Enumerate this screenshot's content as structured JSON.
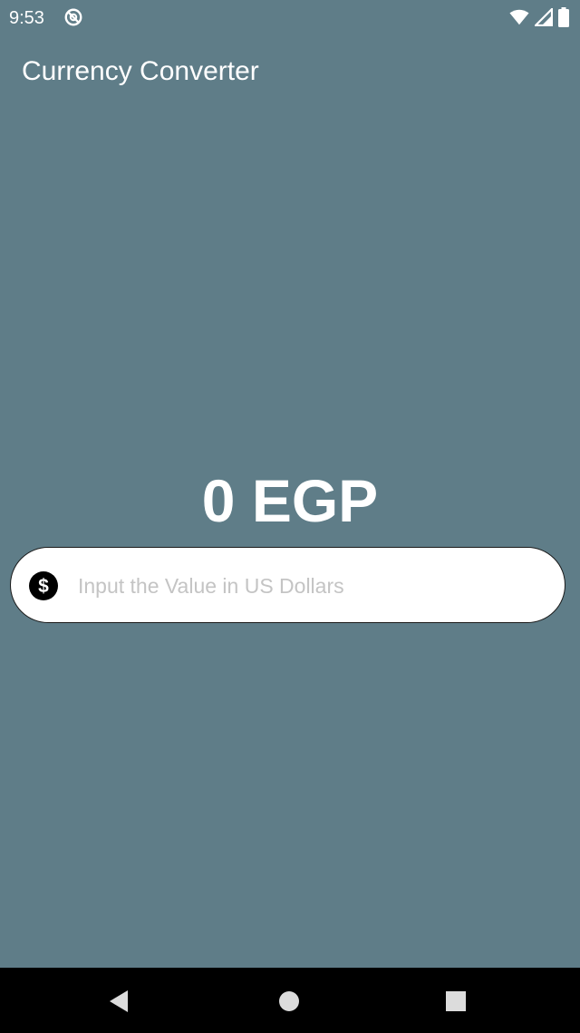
{
  "status_bar": {
    "time": "9:53",
    "icons": [
      "sync-off-icon",
      "wifi-icon",
      "signal-icon",
      "battery-icon"
    ]
  },
  "app": {
    "title": "Currency Converter"
  },
  "converter": {
    "result": "0 EGP",
    "input_value": "",
    "input_placeholder": "Input the Value in US Dollars",
    "input_icon": "dollar-icon"
  },
  "nav_bar": {
    "buttons": [
      "back-icon",
      "home-icon",
      "recents-icon"
    ]
  },
  "colors": {
    "background": "#5f7d88",
    "text": "#ffffff",
    "input_background": "#ffffff",
    "placeholder": "#c4c4c4",
    "nav_bar": "#000000"
  }
}
